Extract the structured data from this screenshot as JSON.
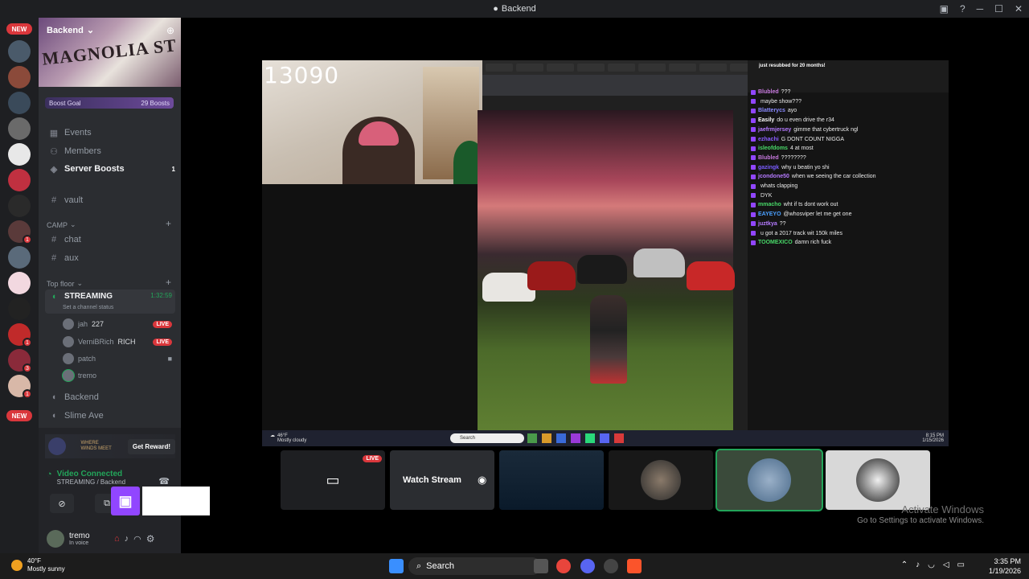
{
  "window": {
    "title": "Backend"
  },
  "server_list": {
    "new_badge_top": "NEW",
    "new_badge_bottom": "NEW",
    "badges": [
      "1",
      "1",
      "3",
      "1"
    ]
  },
  "sidebar": {
    "server_name": "Backend",
    "banner_text": "MAGNOLIA ST",
    "boost_goal": {
      "label": "Boost Goal",
      "count": "29 Boosts"
    },
    "items": [
      {
        "label": "Events",
        "icon": "calendar-icon"
      },
      {
        "label": "Members",
        "icon": "members-icon"
      },
      {
        "label": "Server Boosts",
        "icon": "boost-icon",
        "badge": "1"
      },
      {
        "label": "vault",
        "icon": "hash-icon"
      }
    ],
    "categories": [
      {
        "label": "CAMP",
        "channels": [
          "chat",
          "aux"
        ]
      },
      {
        "label": "Top floor"
      }
    ],
    "voice_channel": {
      "name": "STREAMING",
      "timer": "1:32:59",
      "status": "Set a channel status",
      "users": [
        {
          "name": "jah",
          "extra": "227",
          "live": "LIVE"
        },
        {
          "name": "VerniBRich",
          "extra": "RICH",
          "live": "LIVE"
        },
        {
          "name": "patch"
        },
        {
          "name": "tremo"
        }
      ]
    },
    "more_channels": [
      "Backend",
      "Slime Ave"
    ],
    "promo": {
      "text": "WHERE WINDS MEET",
      "button": "Get Reward!"
    },
    "connection": {
      "status": "Video Connected",
      "channel": "STREAMING / Backend"
    },
    "user": {
      "name": "tremo",
      "status": "In voice"
    }
  },
  "stream": {
    "viewer_overlay": "13090",
    "chat_header": "just resubbed for 20 months!",
    "chat_messages": [
      {
        "user": "Blubled",
        "text": "???",
        "color": "#c678dd"
      },
      {
        "user": "",
        "text": "maybe show???",
        "color": "#7a5cff"
      },
      {
        "user": "Blatterycs",
        "text": "ayo",
        "color": "#8a8aff"
      },
      {
        "user": "Easily",
        "text": "do u even drive the r34",
        "color": "#ffffff"
      },
      {
        "user": "jaefrmjersey",
        "text": "gimme that cybertruck ngl",
        "color": "#b57aff"
      },
      {
        "user": "ezhachi",
        "text": "G DONT COUNT NIGGA",
        "color": "#8a5cff"
      },
      {
        "user": "isleofdoms",
        "text": "4 at most",
        "color": "#48d868"
      },
      {
        "user": "Blubled",
        "text": "????????",
        "color": "#c678dd"
      },
      {
        "user": "gazingk",
        "text": "why u beatin yo shi",
        "color": "#7a5cff"
      },
      {
        "user": "jcondone50",
        "text": "when we seeing the car collection",
        "color": "#b57aff"
      },
      {
        "user": "",
        "text": "whats clapping",
        "color": "#7a5cff"
      },
      {
        "user": "",
        "text": "DYK",
        "color": "#5c7cff"
      },
      {
        "user": "mmacho",
        "text": "wht if ts dont work out",
        "color": "#48d868"
      },
      {
        "user": "EAYEYO",
        "text": "@whosviper let me get one",
        "color": "#4aa0ff"
      },
      {
        "user": "juztkya",
        "text": "??",
        "color": "#b57aff"
      },
      {
        "user": "",
        "text": "u got a 2017 track wit 150k miles",
        "color": "#7a5cff"
      },
      {
        "user": "TOOMEXICO",
        "text": "damn rich fuck",
        "color": "#48d868"
      }
    ],
    "inner_taskbar": {
      "weather": "46°F",
      "weather_desc": "Mostly cloudy",
      "search": "Search",
      "time": "8:15 PM",
      "date": "1/15/2026"
    }
  },
  "thumbnails": {
    "live": "LIVE",
    "watch_label": "Watch Stream"
  },
  "activate": {
    "line1": "Activate Windows",
    "line2": "Go to Settings to activate Windows."
  },
  "taskbar": {
    "weather_temp": "40°F",
    "weather_desc": "Mostly sunny",
    "search": "Search",
    "time": "3:35 PM",
    "date": "1/19/2026"
  }
}
